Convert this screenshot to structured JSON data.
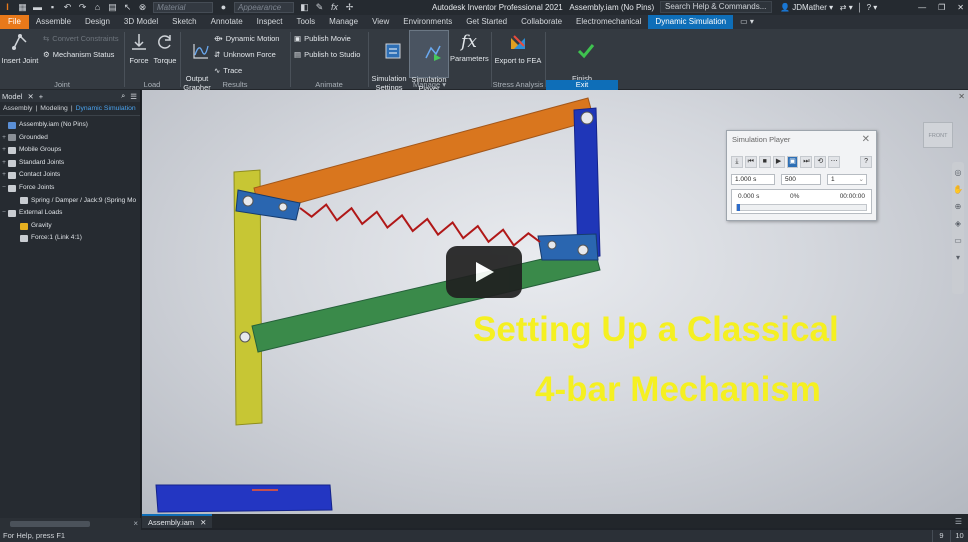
{
  "titlebar": {
    "material_placeholder": "Material",
    "appearance_placeholder": "Appearance",
    "app_title": "Autodesk Inventor Professional 2021",
    "document_title": "Assembly.iam (No Pins)",
    "search_label": "Search Help & Commands...",
    "user": "JDMather"
  },
  "tabs": [
    "File",
    "Assemble",
    "Design",
    "3D Model",
    "Sketch",
    "Annotate",
    "Inspect",
    "Tools",
    "Manage",
    "View",
    "Environments",
    "Get Started",
    "Collaborate",
    "Electromechanical",
    "Dynamic Simulation"
  ],
  "active_tab": "Dynamic Simulation",
  "ribbon": {
    "insert_joint": "Insert Joint",
    "convert_constraints": "Convert Constraints",
    "mechanism_status": "Mechanism Status",
    "force": "Force",
    "torque": "Torque",
    "output_grapher": "Output\nGrapher",
    "dynamic_motion": "Dynamic Motion",
    "unknown_force": "Unknown Force",
    "trace": "Trace",
    "publish_movie": "Publish Movie",
    "publish_to_studio": "Publish to Studio",
    "simulation_settings": "Simulation\nSettings",
    "simulation_player": "Simulation\nPlayer",
    "parameters": "Parameters",
    "export_to_fea": "Export to FEA",
    "finish_dynamic_simulation": "Finish\nDynamic Simulation",
    "groups": {
      "joint": "Joint",
      "load": "Load",
      "results": "Results",
      "animate": "Animate",
      "manage": "Manage ▾",
      "stress_analysis": "Stress Analysis",
      "exit": "Exit"
    }
  },
  "browser": {
    "header": "Model",
    "tabs": [
      "Assembly",
      "Modeling",
      "Dynamic Simulation"
    ],
    "tree": [
      {
        "label": "Assembly.iam (No Pins)",
        "toggle": "",
        "indent": 0,
        "color": "#5a8fd6"
      },
      {
        "label": "Grounded",
        "toggle": "+",
        "indent": 0,
        "color": "#8a8f96"
      },
      {
        "label": "Mobile Groups",
        "toggle": "+",
        "indent": 0,
        "color": "#c9cdd2"
      },
      {
        "label": "Standard Joints",
        "toggle": "+",
        "indent": 0,
        "color": "#c9cdd2"
      },
      {
        "label": "Contact Joints",
        "toggle": "+",
        "indent": 0,
        "color": "#c9cdd2"
      },
      {
        "label": "Force Joints",
        "toggle": "−",
        "indent": 0,
        "color": "#c9cdd2"
      },
      {
        "label": "Spring / Damper / Jack:9 (Spring Mo",
        "toggle": "",
        "indent": 1,
        "color": "#c9cdd2"
      },
      {
        "label": "External Loads",
        "toggle": "−",
        "indent": 0,
        "color": "#c9cdd2"
      },
      {
        "label": "Gravity",
        "toggle": "",
        "indent": 1,
        "color": "#e6b020"
      },
      {
        "label": "Force:1 (Link 4:1)",
        "toggle": "",
        "indent": 1,
        "color": "#c9cdd2"
      }
    ]
  },
  "overlay": {
    "line1": "Setting Up a Classical",
    "line2": "4-bar Mechanism"
  },
  "sim_player": {
    "title": "Simulation Player",
    "final_time": "1.000 s",
    "images": "500",
    "filter": "1",
    "current_time": "0.000 s",
    "percent": "0%",
    "elapsed": "00:00:00",
    "progress": 0.0
  },
  "viewcube_label": "FRONT",
  "document_tab": "Assembly.iam",
  "status": {
    "help_text": "For Help, press F1",
    "num1": "9",
    "num2": "10"
  },
  "colors": {
    "file_tab": "#e8791a",
    "active_tab": "#0e6eb8",
    "overlay_text": "#f5f021",
    "link_orange": "#d9761e",
    "link_blue": "#1f36b8",
    "link_green": "#3a8a4a",
    "link_yellow": "#c7c634",
    "spring": "#b01818"
  }
}
